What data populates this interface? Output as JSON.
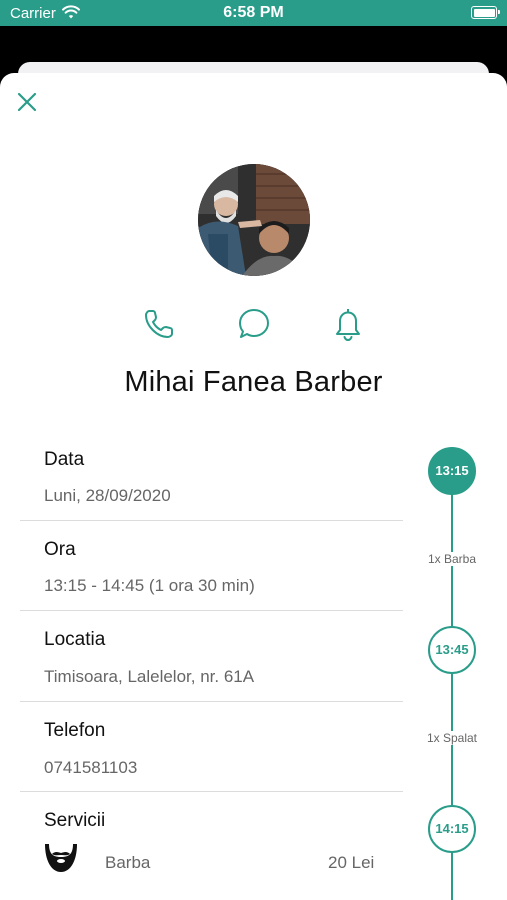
{
  "status_bar": {
    "carrier": "Carrier",
    "time": "6:58 PM"
  },
  "shop": {
    "name": "Mihai Fanea Barber"
  },
  "details": {
    "date": {
      "label": "Data",
      "value": "Luni, 28/09/2020"
    },
    "time": {
      "label": "Ora",
      "value": "13:15 - 14:45 (1 ora 30 min)"
    },
    "location": {
      "label": "Locatia",
      "value": "Timisoara, Lalelelor, nr. 61A"
    },
    "phone": {
      "label": "Telefon",
      "value": "0741581103"
    },
    "services": {
      "label": "Servicii",
      "items": [
        {
          "name": "Barba",
          "price": "20 Lei",
          "icon": "beard-icon"
        }
      ]
    }
  },
  "timeline": {
    "nodes": [
      "13:15",
      "13:45",
      "14:15"
    ],
    "segments": [
      "1x Barba",
      "1x Spalat"
    ]
  },
  "colors": {
    "accent": "#2a9d8a",
    "status_bar": "#2a9d8a"
  }
}
